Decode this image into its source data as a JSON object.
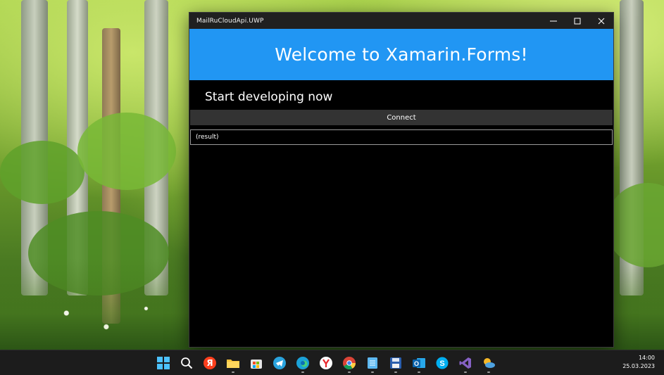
{
  "window": {
    "title": "MailRuCloudApi.UWP",
    "minimize_glyph": "—",
    "maximize_glyph": "☐",
    "close_glyph": "✕"
  },
  "app": {
    "header_text": "Welcome to Xamarin.Forms!",
    "header_color": "#2196f3",
    "subheading": "Start developing now",
    "connect_label": "Connect",
    "result_text": "(result)"
  },
  "taskbar": {
    "icons": [
      "windows-start-icon",
      "search-icon",
      "yandex-icon",
      "file-explorer-icon",
      "microsoft-store-icon",
      "telegram-icon",
      "edge-icon",
      "yandex-browser-icon",
      "chrome-icon",
      "notepad-icon",
      "floppy-app-icon",
      "outlook-icon",
      "skype-icon",
      "visual-studio-icon",
      "weather-icon"
    ],
    "yandex_letter": "Я",
    "time": "14:00",
    "date": "25.03.2023"
  }
}
